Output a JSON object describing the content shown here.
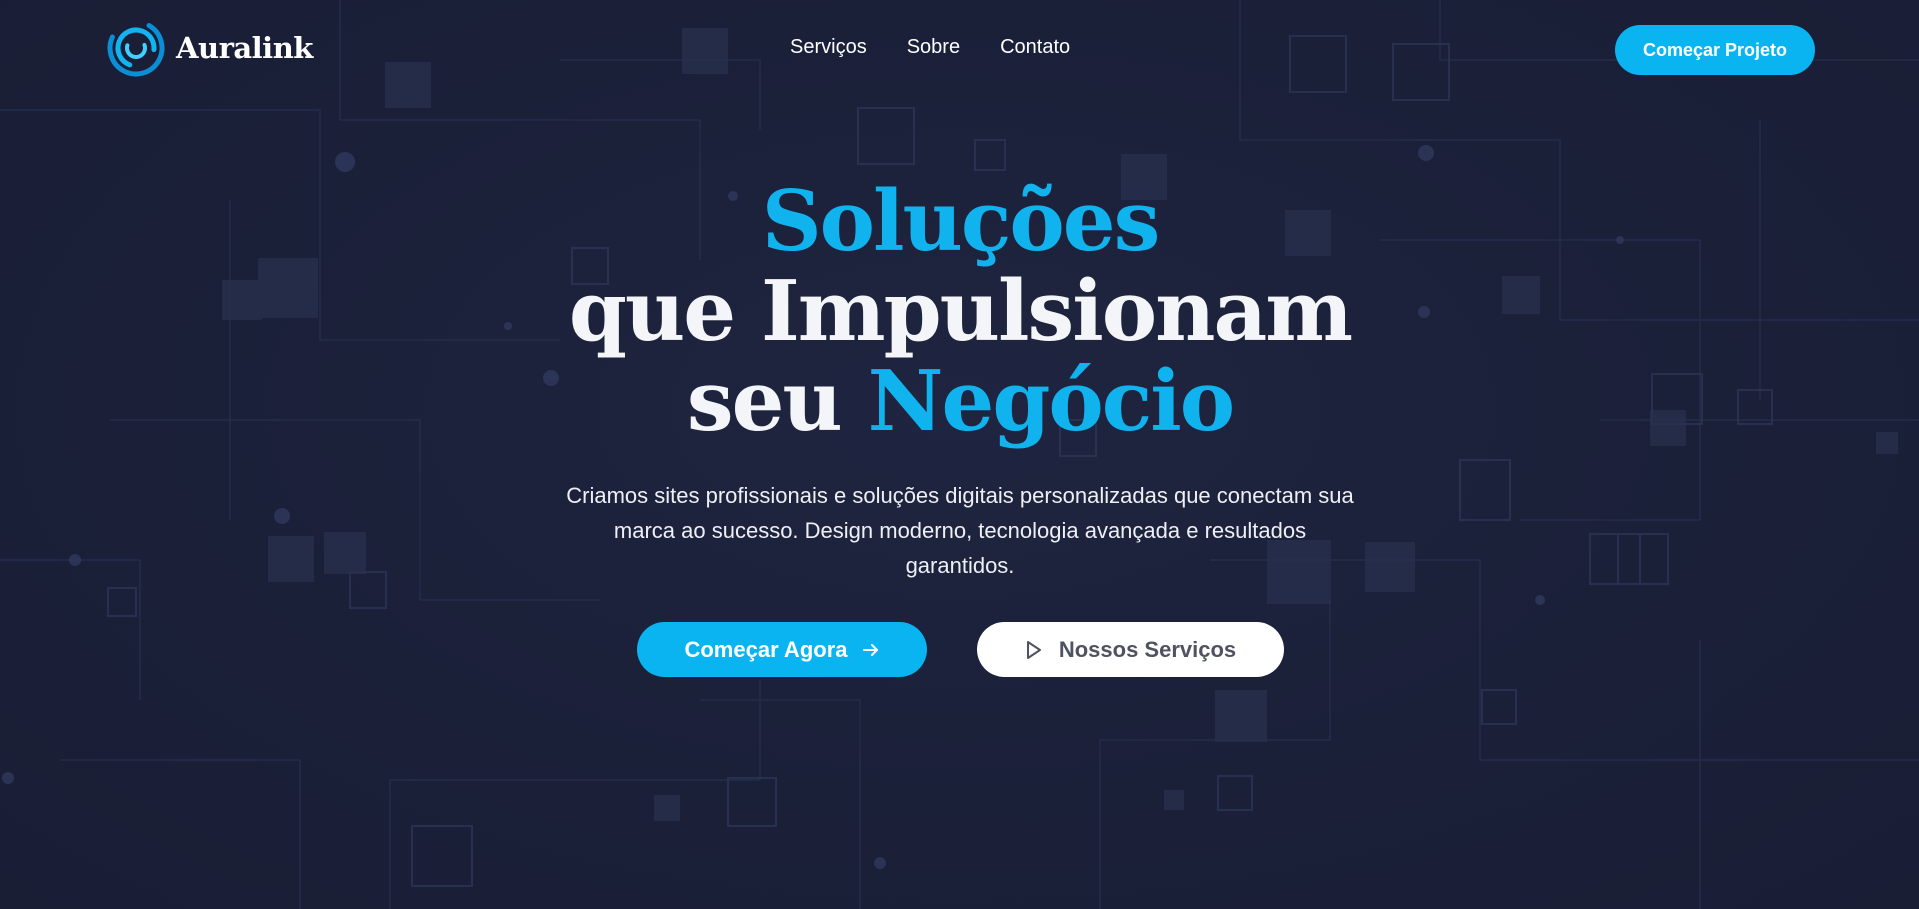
{
  "brand": {
    "name": "Auralink",
    "accent_color": "#0ab4f0",
    "background_color": "#1b2039"
  },
  "nav": {
    "items": [
      {
        "label": "Serviços",
        "icon": "none"
      },
      {
        "label": "Sobre",
        "icon": "none"
      },
      {
        "label": "Contato",
        "icon": "none"
      }
    ],
    "cta_label": "Começar Projeto"
  },
  "hero": {
    "title_word1": "Soluções",
    "title_line2": "que Impulsionam",
    "title_word3": "seu",
    "title_word4": "Negócio",
    "subtitle": "Criamos sites profissionais e soluções digitais personalizadas que conectam sua marca ao sucesso. Design moderno, tecnologia avançada e resultados garantidos.",
    "primary_button": {
      "label": "Começar Agora",
      "icon": "arrow-right-icon"
    },
    "secondary_button": {
      "label": "Nossos Serviços",
      "icon": "play-icon"
    }
  }
}
